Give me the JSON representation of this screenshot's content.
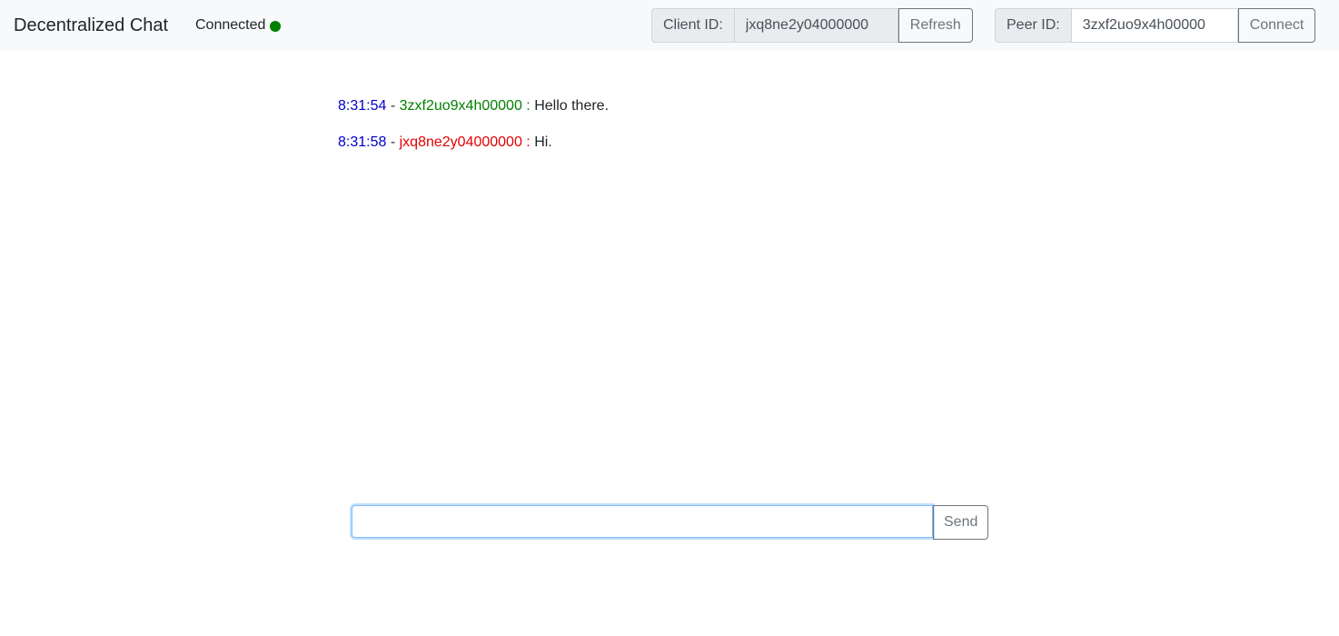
{
  "header": {
    "title": "Decentralized Chat",
    "status_label": "Connected",
    "status_color": "#008000"
  },
  "client": {
    "label": "Client ID:",
    "value": "jxq8ne2y04000000",
    "refresh_label": "Refresh"
  },
  "peer": {
    "label": "Peer ID:",
    "value": "3zxf2uo9x4h00000",
    "connect_label": "Connect"
  },
  "messages": [
    {
      "time": "8:31:54",
      "sender": "3zxf2uo9x4h00000",
      "sender_color": "#008000",
      "text": "Hello there."
    },
    {
      "time": "8:31:58",
      "sender": "jxq8ne2y04000000",
      "sender_color": "#e60000",
      "text": "Hi."
    }
  ],
  "composer": {
    "value": "",
    "send_label": "Send"
  }
}
